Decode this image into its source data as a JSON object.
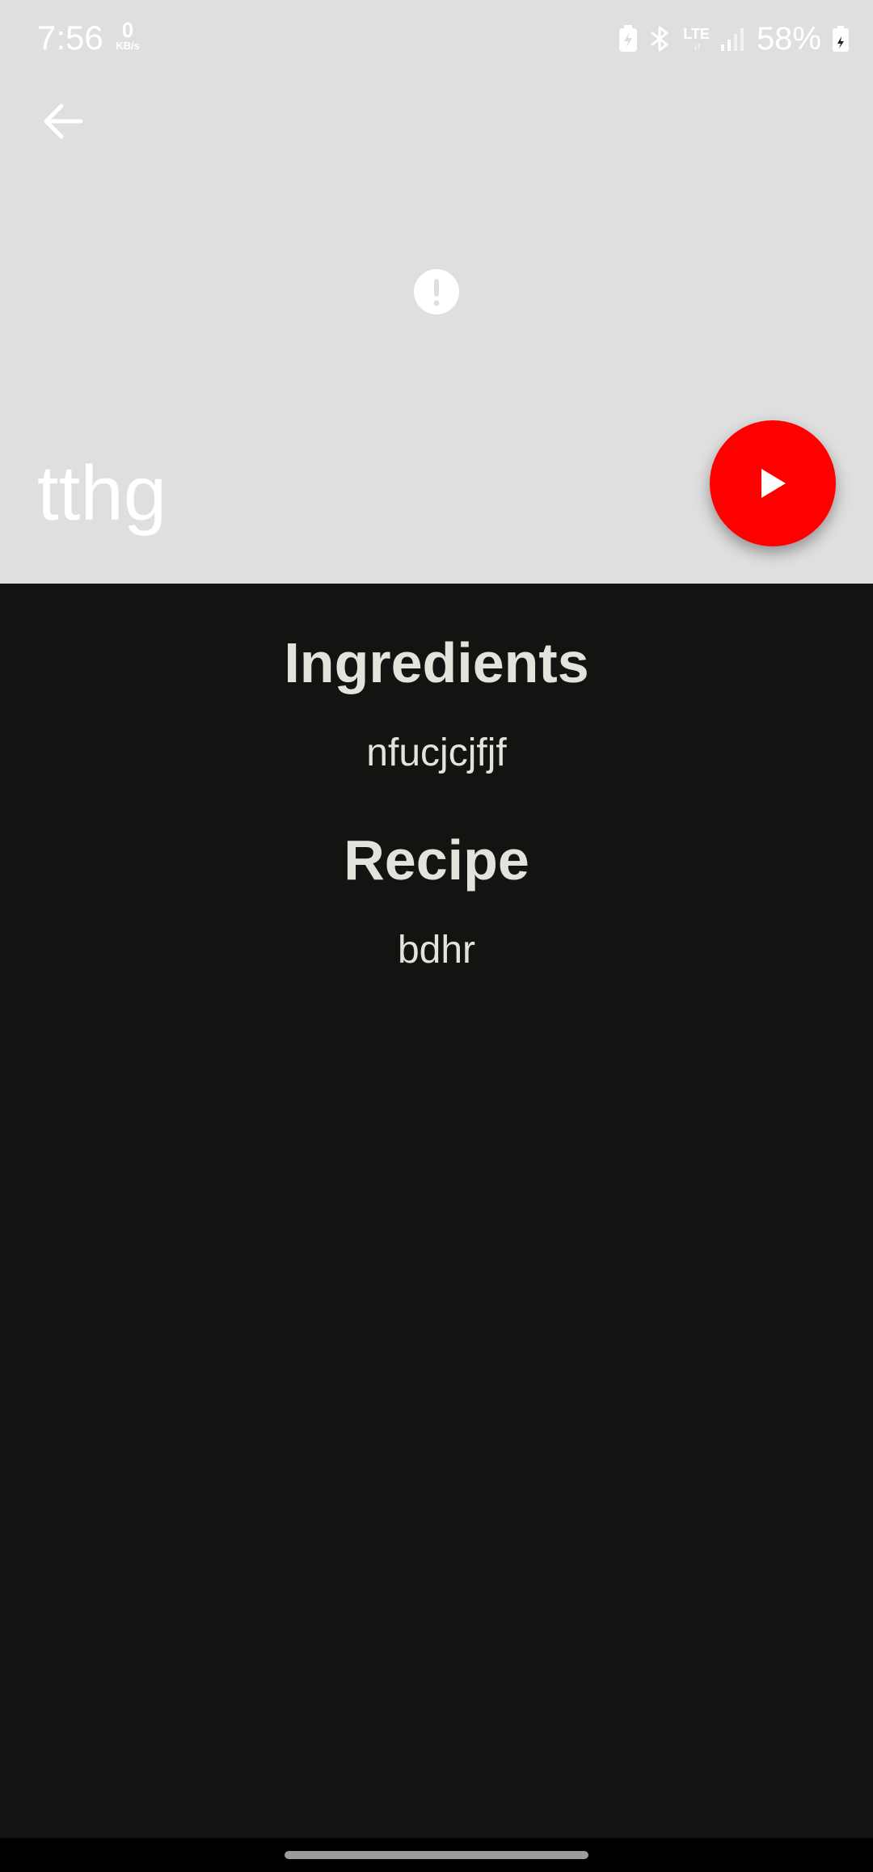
{
  "status_bar": {
    "time": "7:56",
    "net_speed_value": "0",
    "net_speed_unit": "KB/s",
    "network_type": "LTE",
    "battery_percent": "58%"
  },
  "header": {
    "back_icon": "arrow-back-icon",
    "image_status_icon": "error-icon",
    "title": "tthg",
    "play_icon": "play-icon",
    "background_color": "#dfdfdf",
    "fab_color": "#ff0000"
  },
  "sections": {
    "ingredients_heading": "Ingredients",
    "ingredients_text": "nfucjcjfjf",
    "recipe_heading": "Recipe",
    "recipe_text": "bdhr"
  },
  "theme": {
    "content_background": "#121411",
    "content_text": "#e2e4dc"
  }
}
